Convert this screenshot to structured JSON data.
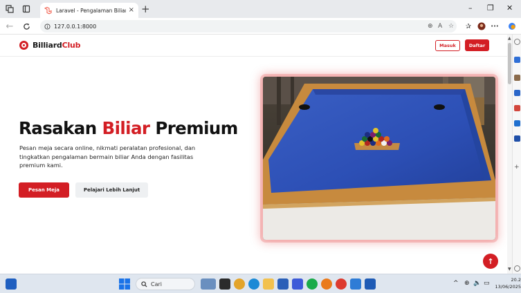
{
  "browser": {
    "tab_title": "Laravel - Pengalaman Biliar Premi",
    "tab_close": "×",
    "new_tab": "+",
    "url": "127.0.0.1:8000",
    "min": "–",
    "restore": "❐",
    "close": "✕",
    "menu": "···"
  },
  "site": {
    "brand_main": "Billiard",
    "brand_accent": "Club",
    "login_label": "Masuk",
    "register_label": "Daftar"
  },
  "hero": {
    "title_before": "Rasakan ",
    "title_accent": "Biliar",
    "title_after": " Premium",
    "description": "Pesan meja secara online, nikmati peralatan profesional, dan tingkatkan pengalaman bermain biliar Anda dengan fasilitas premium kami.",
    "primary_cta": "Pesan Meja",
    "secondary_cta": "Pelajari Lebih Lanjut",
    "back_to_top": "↑"
  },
  "taskbar": {
    "search_placeholder": "Cari",
    "time": "20.2",
    "date": "13/06/2025",
    "chevron": "^"
  },
  "colors": {
    "brand_red": "#d31e24",
    "felt_blue": "#2c4fb5"
  }
}
